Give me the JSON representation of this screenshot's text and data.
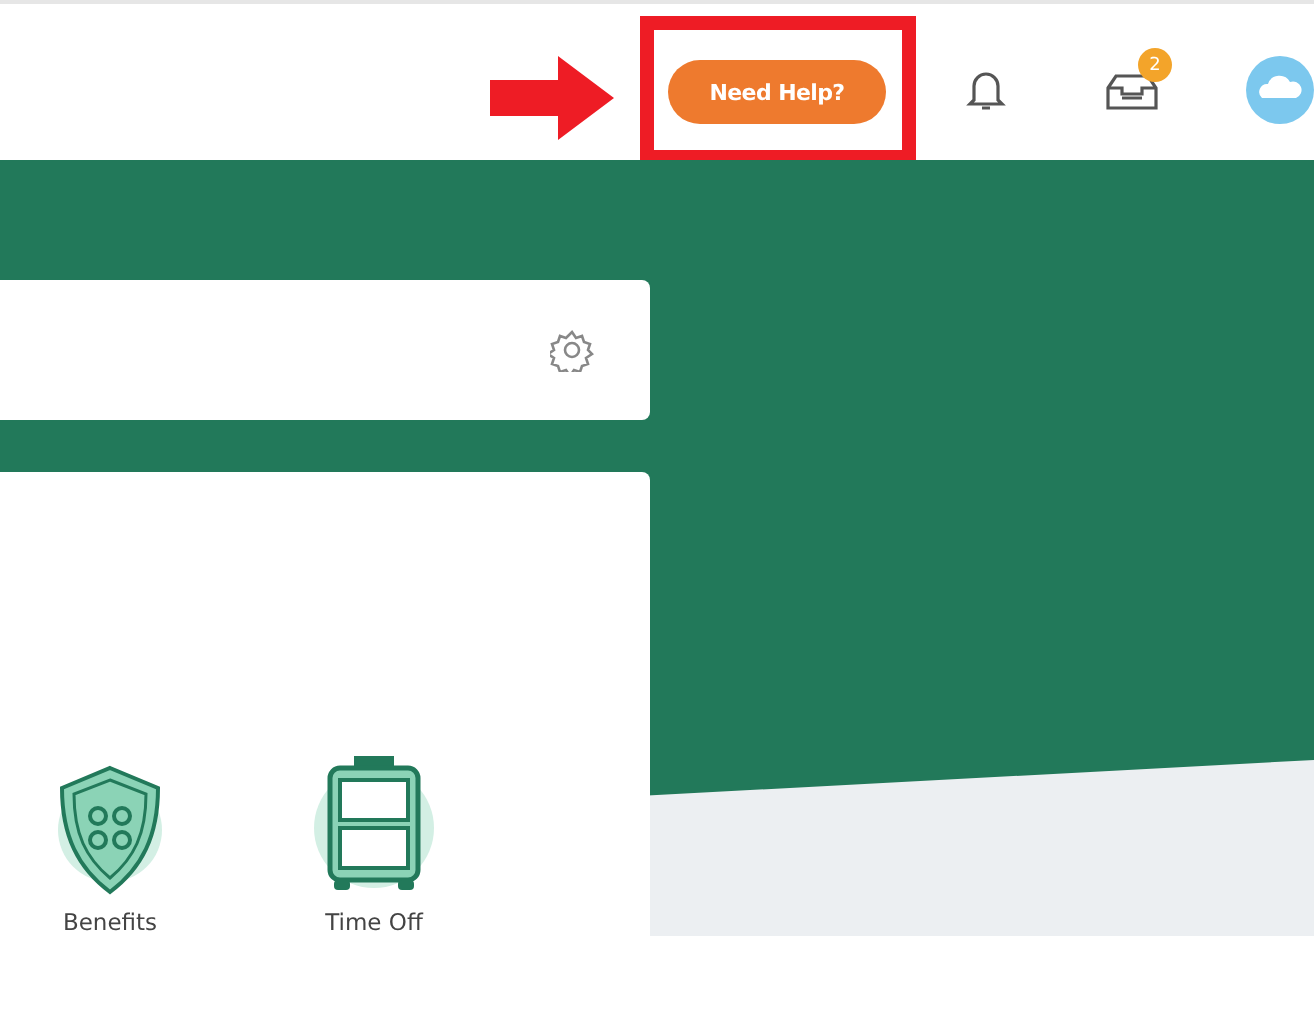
{
  "header": {
    "help_button": {
      "label": "Need Help?"
    },
    "inbox": {
      "badge": "2"
    }
  },
  "tiles": [
    {
      "label": "Benefits",
      "kind": "shield"
    },
    {
      "label": "Time Off",
      "kind": "suitcase"
    }
  ]
}
